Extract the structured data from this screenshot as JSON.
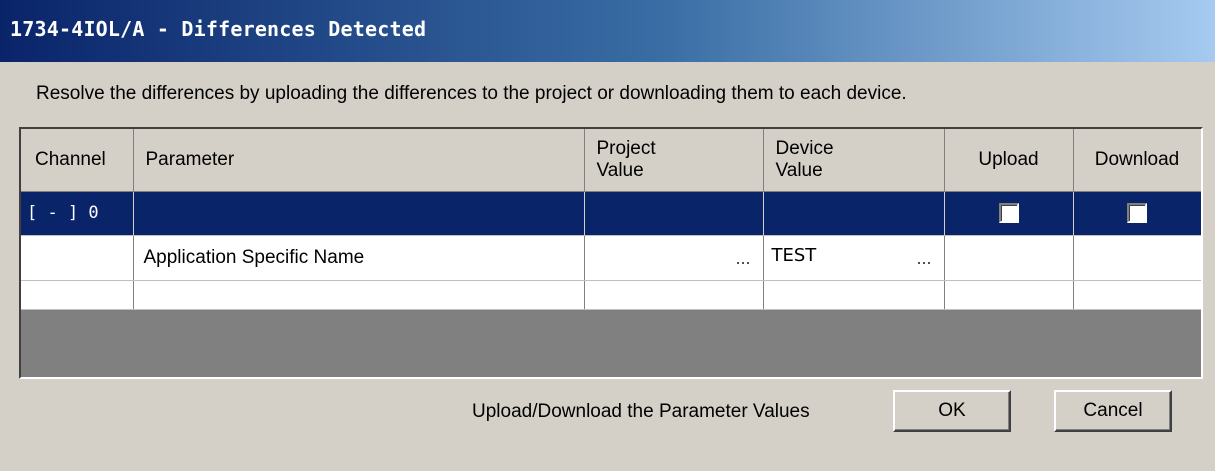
{
  "window": {
    "title": "1734-4IOL/A - Differences Detected"
  },
  "instructions": "Resolve the differences by uploading the differences to the project or downloading them to each device.",
  "table": {
    "headers": {
      "channel": "Channel",
      "parameter": "Parameter",
      "project_value_1": "Project",
      "project_value_2": "Value",
      "device_value_1": "Device",
      "device_value_2": "Value",
      "upload": "Upload",
      "download": "Download"
    },
    "group_row": {
      "channel": "[ - ] 0",
      "upload_checked": false,
      "download_checked": false
    },
    "rows": [
      {
        "channel": "",
        "parameter": "Application Specific Name",
        "project_value": "",
        "project_ellipsis": "...",
        "device_value": "TEST",
        "device_ellipsis": "..."
      }
    ]
  },
  "footer": {
    "label": "Upload/Download the Parameter Values",
    "ok_label": "OK",
    "cancel_label": "Cancel"
  },
  "colors": {
    "title_start": "#0a246a",
    "title_end": "#a6caf0",
    "selection": "#0a246a",
    "dialog_bg": "#d4d0c8"
  }
}
